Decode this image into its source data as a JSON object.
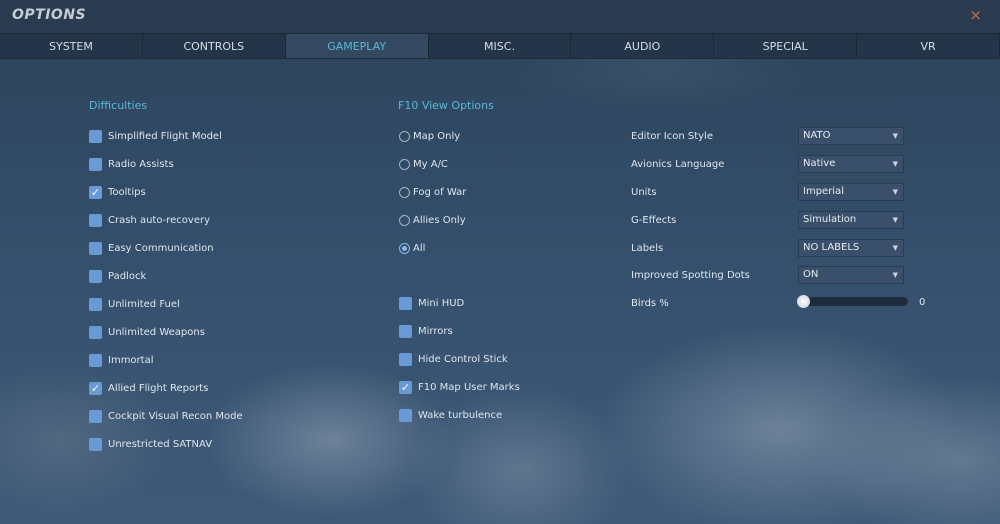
{
  "window": {
    "title": "OPTIONS",
    "close_icon": "×"
  },
  "tabs": [
    {
      "label": "SYSTEM"
    },
    {
      "label": "CONTROLS"
    },
    {
      "label": "GAMEPLAY",
      "active": true
    },
    {
      "label": "MISC."
    },
    {
      "label": "AUDIO"
    },
    {
      "label": "SPECIAL"
    },
    {
      "label": "VR"
    }
  ],
  "difficulties": {
    "heading": "Difficulties",
    "items": [
      {
        "label": "Simplified Flight Model",
        "checked": false
      },
      {
        "label": "Radio Assists",
        "checked": false
      },
      {
        "label": "Tooltips",
        "checked": true
      },
      {
        "label": "Crash auto-recovery",
        "checked": false
      },
      {
        "label": "Easy Communication",
        "checked": false
      },
      {
        "label": "Padlock",
        "checked": false
      },
      {
        "label": "Unlimited Fuel",
        "checked": false
      },
      {
        "label": "Unlimited Weapons",
        "checked": false
      },
      {
        "label": "Immortal",
        "checked": false
      },
      {
        "label": "Allied Flight Reports",
        "checked": true
      },
      {
        "label": "Cockpit Visual Recon Mode",
        "checked": false
      },
      {
        "label": "Unrestricted SATNAV",
        "checked": false
      }
    ]
  },
  "f10": {
    "heading": "F10 View Options",
    "radios": [
      {
        "label": "Map Only",
        "selected": false
      },
      {
        "label": "My A/C",
        "selected": false
      },
      {
        "label": "Fog of War",
        "selected": false
      },
      {
        "label": "Allies Only",
        "selected": false
      },
      {
        "label": "All",
        "selected": true
      }
    ],
    "checks": [
      {
        "label": "Mini HUD",
        "checked": false
      },
      {
        "label": "Mirrors",
        "checked": false
      },
      {
        "label": "Hide Control Stick",
        "checked": false
      },
      {
        "label": "F10 Map User Marks",
        "checked": true
      },
      {
        "label": "Wake turbulence",
        "checked": false
      }
    ]
  },
  "settings": [
    {
      "label": "Editor Icon Style",
      "value": "NATO"
    },
    {
      "label": "Avionics Language",
      "value": "Native"
    },
    {
      "label": "Units",
      "value": "Imperial"
    },
    {
      "label": "G-Effects",
      "value": "Simulation"
    },
    {
      "label": "Labels",
      "value": "NO LABELS"
    },
    {
      "label": "Improved Spotting Dots",
      "value": "ON"
    }
  ],
  "birds": {
    "label": "Birds %",
    "value": "0",
    "fraction": 0
  }
}
